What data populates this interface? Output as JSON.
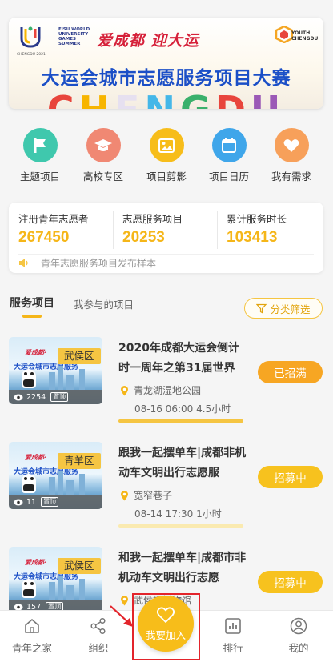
{
  "banner": {
    "fisu_text": "FISU WORLD UNIVERSITY GAMES SUMMER",
    "city_left": "CHENGDU 2021",
    "slogan": "爱成都 迎大运",
    "youth_text": "YOUTH CHENGDU",
    "title": "大运会城市志愿服务项目大赛",
    "big_letters": [
      "C",
      "H",
      "E",
      "N",
      "G",
      "D",
      "U"
    ],
    "big_colors": [
      "#e8453c",
      "#f7b500",
      "#e6e0f0",
      "#45b7e8",
      "#3ab06b",
      "#e8453c",
      "#9b59b6"
    ]
  },
  "quick_links": [
    {
      "label": "主题项目",
      "icon": "flag-icon",
      "color": "#3fc8ad"
    },
    {
      "label": "高校专区",
      "icon": "graduation-cap-icon",
      "color": "#f08873"
    },
    {
      "label": "项目剪影",
      "icon": "picture-icon",
      "color": "#f7bd1a"
    },
    {
      "label": "项目日历",
      "icon": "calendar-icon",
      "color": "#3fa6ea"
    },
    {
      "label": "我有需求",
      "icon": "heart-icon",
      "color": "#f7a05a"
    }
  ],
  "stats": [
    {
      "label": "注册青年志愿者",
      "value": "267450"
    },
    {
      "label": "志愿服务项目",
      "value": "20253"
    },
    {
      "label": "累计服务时长",
      "value": "103413"
    }
  ],
  "notice": {
    "icon": "speaker-icon",
    "text": "青年志愿服务项目发布样本"
  },
  "tabs": {
    "active": "服务项目",
    "other": "我参与的项目",
    "filter_label": "分类筛选",
    "filter_icon": "filter-icon"
  },
  "projects": [
    {
      "district": "武侯区",
      "views": "2254",
      "pin": "置顶",
      "title": "2020年成都大运会倒计时一周年之第31届世界",
      "location": "青龙湖湿地公园",
      "time": "08-16 06:00 4.5小时",
      "status": "已招满",
      "status_color": "#f7a623",
      "bar_color": "#f5c542",
      "thumb_line1": "爱成都·",
      "thumb_line2": "大运会城市志愿服务"
    },
    {
      "district": "青羊区",
      "views": "11",
      "pin": "置顶",
      "title": "跟我一起摆单车|成都非机动车文明出行志愿服",
      "location": "宽窄巷子",
      "time": "08-14 17:30 1小时",
      "status": "招募中",
      "status_color": "#f7c21e",
      "bar_color": "#faeab0",
      "thumb_line1": "爱成都·",
      "thumb_line2": "大运会城市志愿服务"
    },
    {
      "district": "武侯区",
      "views": "157",
      "pin": "置顶",
      "title": "和我一起摆单车|成都市非机动车文明出行志愿",
      "location": "武侯祠博物馆",
      "time": "",
      "status": "招募中",
      "status_color": "#f7c21e",
      "bar_color": "#faeab0",
      "thumb_line1": "爱成都·",
      "thumb_line2": "大运会城市志愿服务"
    }
  ],
  "tabbar": [
    {
      "label": "青年之家",
      "icon": "home-icon"
    },
    {
      "label": "组织",
      "icon": "share-icon"
    },
    {
      "label": "我要加入",
      "icon": "heart-icon"
    },
    {
      "label": "排行",
      "icon": "ranking-icon"
    },
    {
      "label": "我的",
      "icon": "user-icon"
    }
  ]
}
